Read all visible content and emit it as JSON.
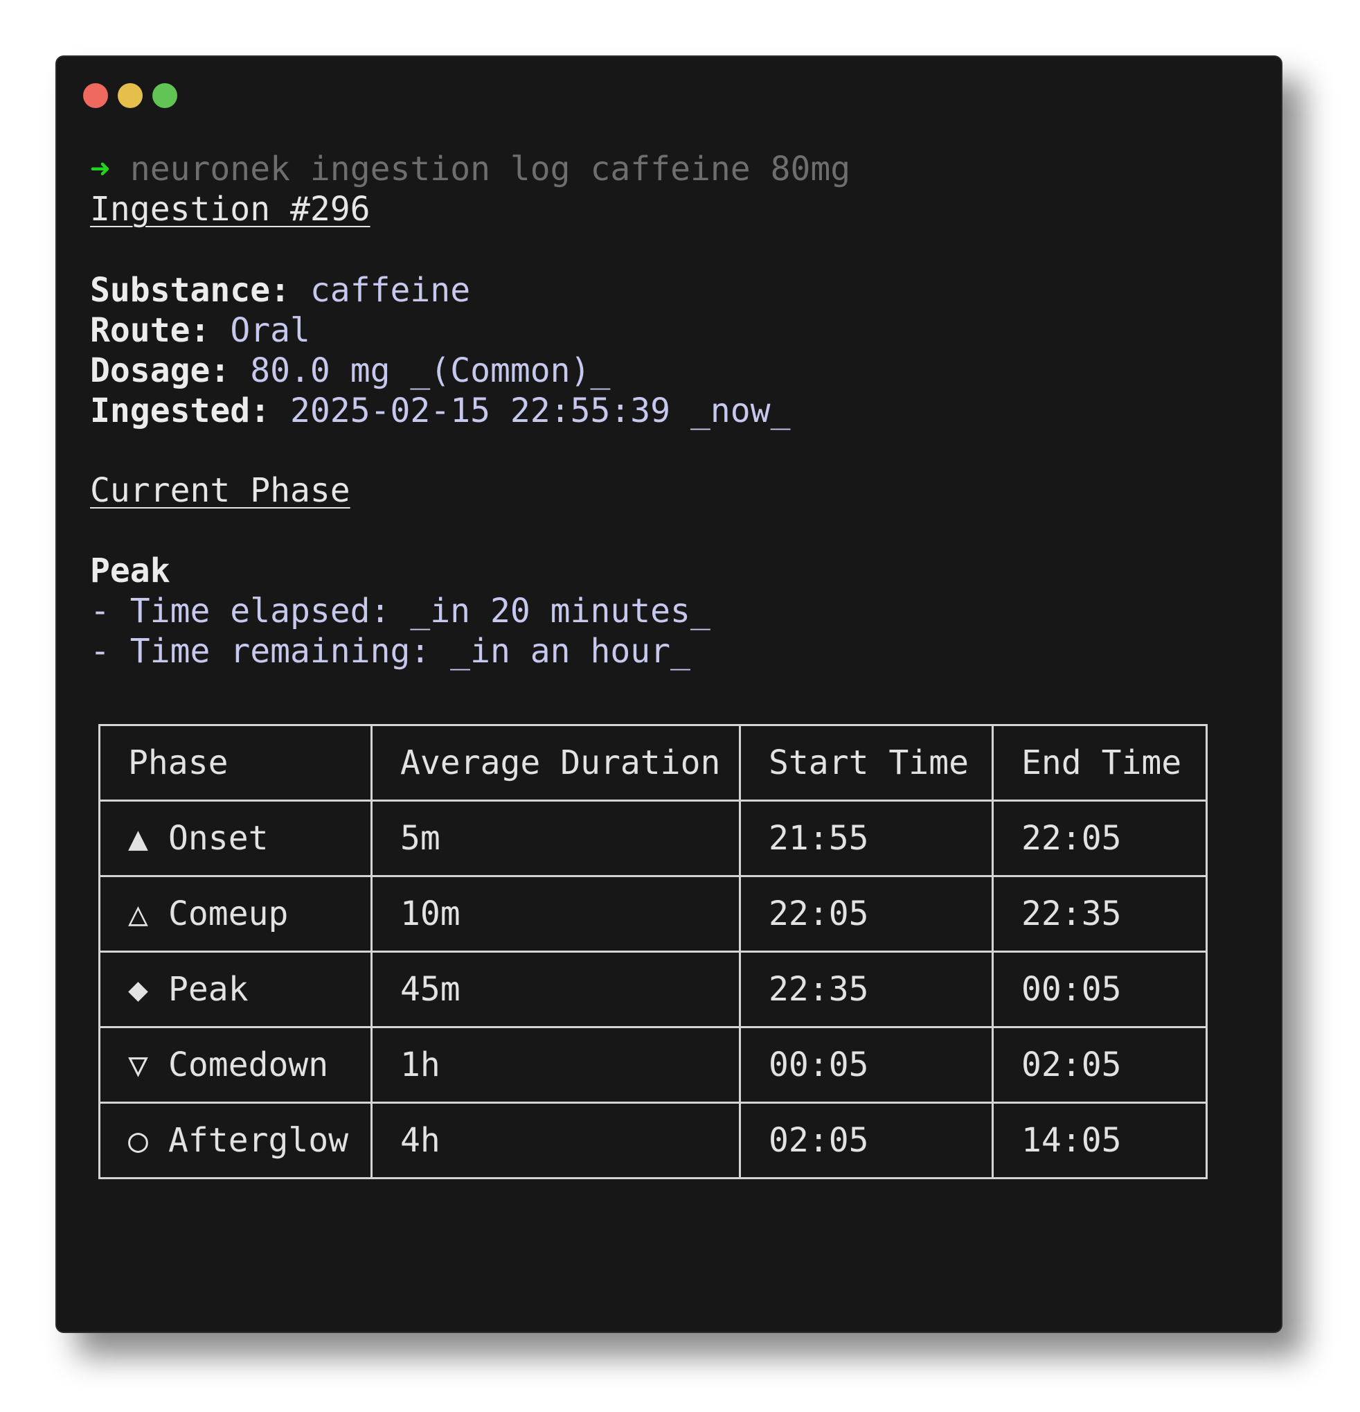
{
  "window": {
    "controls": [
      {
        "name": "close",
        "color": "#ee6a5f"
      },
      {
        "name": "minimize",
        "color": "#e5bf4c"
      },
      {
        "name": "maximize",
        "color": "#61c454"
      }
    ]
  },
  "prompt": {
    "arrow": "➜",
    "command": "neuronek ingestion log caffeine 80mg"
  },
  "ingestion": {
    "heading": "Ingestion #296",
    "fields": [
      {
        "label": "Substance",
        "value": "caffeine"
      },
      {
        "label": "Route",
        "value": "Oral"
      },
      {
        "label": "Dosage",
        "value": "80.0 mg _(Common)_"
      },
      {
        "label": "Ingested",
        "value": "2025-02-15 22:55:39 _now_"
      }
    ]
  },
  "current_phase": {
    "heading": "Current Phase",
    "name": "Peak",
    "details": [
      "- Time elapsed: _in 20 minutes_",
      "- Time remaining: _in an hour_"
    ]
  },
  "table": {
    "headers": [
      "Phase",
      "Average Duration",
      "Start Time",
      "End Time"
    ],
    "rows": [
      {
        "icon": "▲",
        "phase": "Onset",
        "duration": "5m",
        "start": "21:55",
        "end": "22:05"
      },
      {
        "icon": "△",
        "phase": "Comeup",
        "duration": "10m",
        "start": "22:05",
        "end": "22:35"
      },
      {
        "icon": "◆",
        "phase": "Peak",
        "duration": "45m",
        "start": "22:35",
        "end": "00:05"
      },
      {
        "icon": "▽",
        "phase": "Comedown",
        "duration": "1h",
        "start": "00:05",
        "end": "02:05"
      },
      {
        "icon": "○",
        "phase": "Afterglow",
        "duration": "4h",
        "start": "02:05",
        "end": "14:05"
      }
    ]
  }
}
